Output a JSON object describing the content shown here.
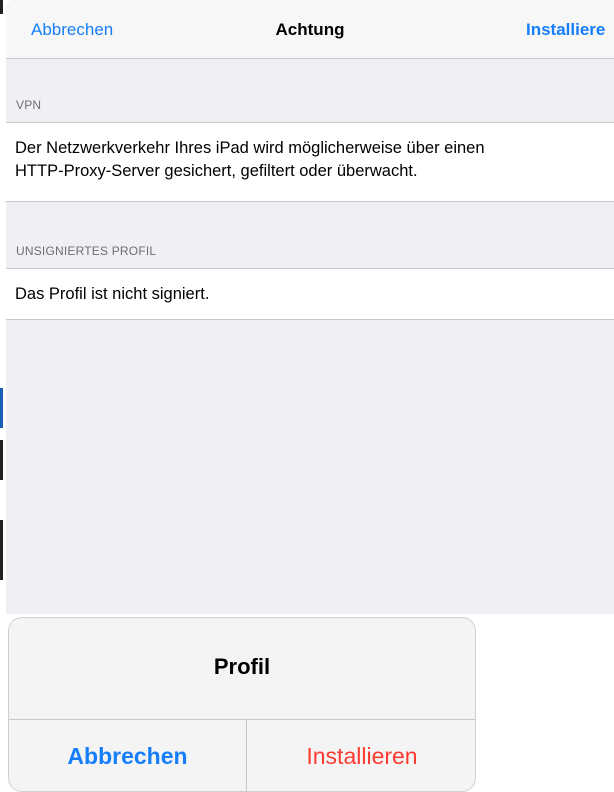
{
  "navbar": {
    "cancel_label": "Abbrechen",
    "title": "Achtung",
    "install_label": "Installiere"
  },
  "sections": [
    {
      "header": "VPN",
      "text_line1": "Der Netzwerkverkehr Ihres iPad wird möglicherweise über einen",
      "text_line2": "HTTP-Proxy-Server gesichert, gefiltert oder überwacht."
    },
    {
      "header": "UNSIGNIERTES PROFIL",
      "text_line1": "Das Profil ist nicht signiert."
    }
  ],
  "alert": {
    "title": "Profil",
    "cancel_label": "Abbrechen",
    "install_label": "Installieren"
  },
  "colors": {
    "accent": "#157efb",
    "destructive": "#ff3b30",
    "background": "#efeff4"
  }
}
